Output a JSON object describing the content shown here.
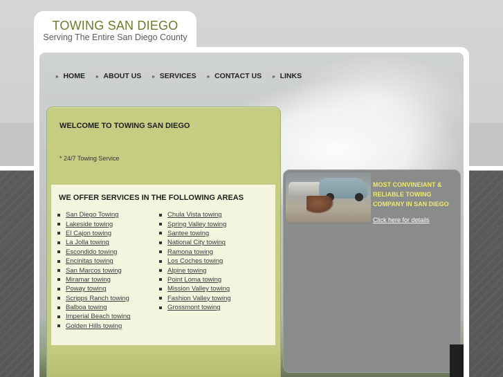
{
  "header": {
    "title": "TOWING SAN DIEGO",
    "subtitle": "Serving The Entire San Diego County"
  },
  "nav": {
    "items": [
      {
        "label": "HOME"
      },
      {
        "label": "ABOUT US"
      },
      {
        "label": "SERVICES"
      },
      {
        "label": "CONTACT US"
      },
      {
        "label": "LINKS"
      }
    ]
  },
  "welcome": {
    "title": "WELCOME TO TOWING SAN DIEGO",
    "text": "* 24/7 Towing Service"
  },
  "services": {
    "title": "WE OFFER SERVICES IN THE FOLLOWING AREAS",
    "col1": [
      "San Diego Towing",
      "Lakeside towing",
      "El Cajon towing",
      "La Jolla towing",
      "Escondido towing",
      "Encinitas towing",
      "San Marcos towing",
      "Miramar towing",
      "Poway towing",
      "Scripps Ranch towing",
      "Balboa towing",
      "Imperial Beach towing",
      "Golden Hills towing"
    ],
    "col2": [
      "Chula Vista towing",
      "Spring Valley towing",
      "Santee towing",
      "National City towing",
      "Ramona towing",
      "Los Coches towing",
      "Alpine towing",
      "Point Loma towing",
      "Mission Valley towing",
      "Fashion Valley towing",
      "Grossmont towing"
    ]
  },
  "promo": {
    "headline": "MOST CONVINEIANT & RELIABLE TOWING COMPANY IN SAN DIEGO",
    "link": "Click here for details"
  },
  "colors": {
    "title": "#6f7a2c",
    "panel": "#c4cd82",
    "promo_bg": "#8a8b8b",
    "promo_headline": "#f0ea6a"
  }
}
